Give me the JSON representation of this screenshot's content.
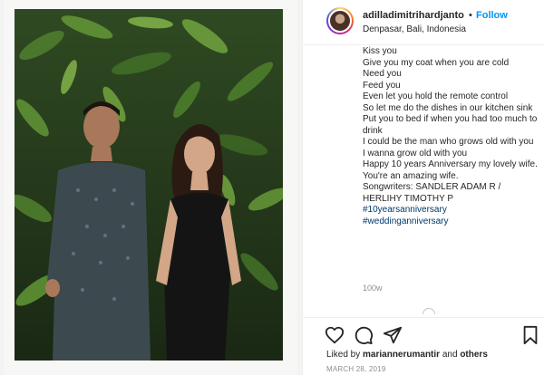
{
  "post": {
    "username": "adilladimitrihardjanto",
    "dot": "•",
    "follow_label": "Follow",
    "location": "Denpasar, Bali, Indonesia",
    "caption_lines": [
      "Kiss you",
      "Give you my coat when you are cold",
      "Need you",
      "Feed you",
      "Even let you hold the remote control",
      "So let me do the dishes in our kitchen sink",
      "Put you to bed if when you had too much to drink",
      "I could be the man who grows old with you",
      "I wanna grow old with you",
      "Happy 10 years Anniversary my lovely wife. You're an amazing wife.",
      "Songwriters: SANDLER ADAM R / HERLIHY TIMOTHY P"
    ],
    "hashtags": [
      "#10yearsanniversary",
      "#weddinganniversary"
    ],
    "time_ago": "100w",
    "liked_by_prefix": "Liked by ",
    "liked_by_user": "mariannerumantir",
    "liked_by_and": " and ",
    "liked_by_others": "others",
    "date": "MARCH 28, 2019"
  },
  "icons": {
    "like": "heart-icon",
    "comment": "comment-icon",
    "share": "paper-plane-icon",
    "save": "bookmark-icon"
  },
  "colors": {
    "link": "#0095f6",
    "hashtag": "#00376b",
    "muted": "#8e8e8e",
    "text": "#262626"
  }
}
